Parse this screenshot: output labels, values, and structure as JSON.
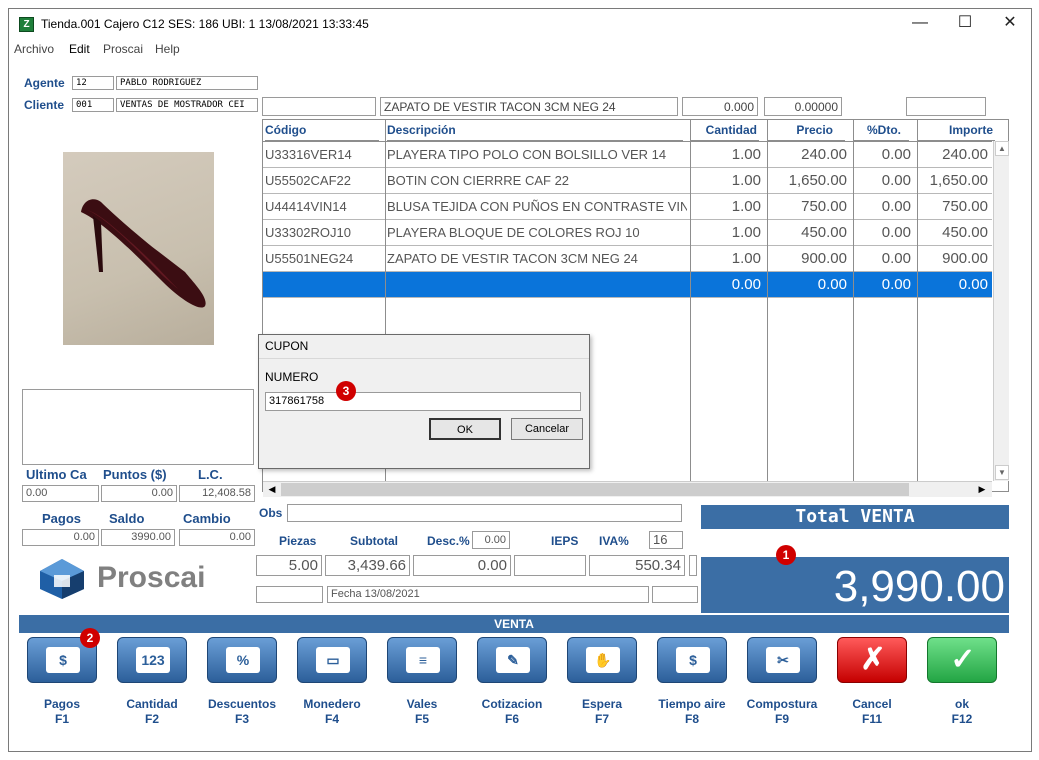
{
  "window": {
    "title": "Tienda.001  Cajero C12     SES: 186  UBI: 1   13/08/2021 13:33:45",
    "minimize": "—",
    "maximize": "☐",
    "close": "✕"
  },
  "menu": [
    "Archivo",
    "Edit",
    "Proscai",
    "Help"
  ],
  "customer": {
    "agente_label": "Agente",
    "agente_code": "12",
    "agente_name": "PABLO RODRIGUEZ",
    "cliente_label": "Cliente",
    "cliente_code": "001",
    "cliente_name": "VENTAS DE MOSTRADOR CEI"
  },
  "entry": {
    "code": "",
    "description": "ZAPATO DE VESTIR TACON 3CM NEG 24",
    "qty": "0.000",
    "price": "0.00000",
    "extra": ""
  },
  "table": {
    "headers": [
      "Código",
      "Descripción",
      "Cantidad",
      "Precio",
      "%Dto.",
      "Importe"
    ],
    "rows": [
      [
        "U33316VER14",
        "PLAYERA TIPO POLO CON BOLSILLO VER 14",
        "1.00",
        "240.00",
        "0.00",
        "240.00"
      ],
      [
        "U55502CAF22",
        "BOTIN  CON CIERRRE CAF 22",
        "1.00",
        "1,650.00",
        "0.00",
        "1,650.00"
      ],
      [
        "U44414VIN14",
        "BLUSA TEJIDA CON PUÑOS EN CONTRASTE VIN 14",
        "1.00",
        "750.00",
        "0.00",
        "750.00"
      ],
      [
        "U33302ROJ10",
        "PLAYERA BLOQUE DE COLORES ROJ 10",
        "1.00",
        "450.00",
        "0.00",
        "450.00"
      ],
      [
        "U55501NEG24",
        "ZAPATO DE VESTIR TACON 3CM NEG 24",
        "1.00",
        "900.00",
        "0.00",
        "900.00"
      ],
      [
        "",
        "",
        "0.00",
        "0.00",
        "0.00",
        "0.00"
      ]
    ],
    "selected_row": 5
  },
  "dialog": {
    "title": "CUPON",
    "field_label": "NUMERO",
    "field_value": "317861758",
    "ok": "OK",
    "cancel": "Cancelar"
  },
  "stats": {
    "ultimo_label": "Ultimo Ca",
    "puntos_label": "Puntos ($)",
    "lc_label": "L.C.",
    "ultimo_value": "0.00",
    "puntos_value": "0.00",
    "lc_value": "12,408.58",
    "pagos_label": "Pagos",
    "saldo_label": "Saldo",
    "cambio_label": "Cambio",
    "pagos_value": "0.00",
    "saldo_value": "3990.00",
    "cambio_value": "0.00"
  },
  "summary": {
    "obs_label": "Obs",
    "piezas_label": "Piezas",
    "subtotal_label": "Subtotal",
    "desc_label": "Desc.%",
    "desc_pct": "0.00",
    "ieps_label": "IEPS",
    "iva_label": "IVA%",
    "iva_pct": "16",
    "piezas": "5.00",
    "subtotal": "3,439.66",
    "desc_amount": "0.00",
    "ieps_amount": "",
    "iva_amount": "550.34",
    "fecha": "Fecha 13/08/2021"
  },
  "total": {
    "label": "Total VENTA",
    "value": "3,990.00"
  },
  "brand": "Proscai",
  "section_title": "VENTA",
  "badges": [
    "1",
    "2",
    "3"
  ],
  "buttons": [
    {
      "label": "Pagos",
      "key": "F1",
      "icon": "cash-icon",
      "glyph": "$"
    },
    {
      "label": "Cantidad",
      "key": "F2",
      "icon": "keypad-icon",
      "glyph": "123"
    },
    {
      "label": "Descuentos",
      "key": "F3",
      "icon": "percent-icon",
      "glyph": "%"
    },
    {
      "label": "Monedero",
      "key": "F4",
      "icon": "card-icon",
      "glyph": "▭"
    },
    {
      "label": "Vales",
      "key": "F5",
      "icon": "voucher-icon",
      "glyph": "≡"
    },
    {
      "label": "Cotizacion",
      "key": "F6",
      "icon": "quote-icon",
      "glyph": "✎"
    },
    {
      "label": "Espera",
      "key": "F7",
      "icon": "hand-icon",
      "glyph": "✋"
    },
    {
      "label": "Tiempo aire",
      "key": "F8",
      "icon": "phone-icon",
      "glyph": "$"
    },
    {
      "label": "Compostura",
      "key": "F9",
      "icon": "scissors-icon",
      "glyph": "✂"
    },
    {
      "label": "Cancel",
      "key": "F11",
      "icon": "cancel-icon",
      "glyph": "✗"
    },
    {
      "label": "ok",
      "key": "F12",
      "icon": "check-icon",
      "glyph": "✓"
    }
  ],
  "colors": {
    "accent": "#3b6ea5",
    "label_blue": "#1f4e8c",
    "selection": "#0a74da",
    "badge": "#d00000"
  }
}
